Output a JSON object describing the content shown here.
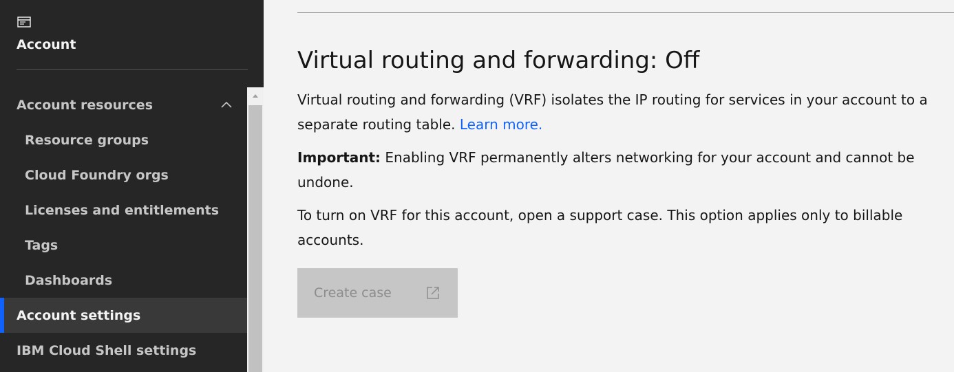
{
  "sidebar": {
    "title": "Account",
    "section_label": "Account resources",
    "items": [
      {
        "label": "Resource groups"
      },
      {
        "label": "Cloud Foundry orgs"
      },
      {
        "label": "Licenses and entitlements"
      },
      {
        "label": "Tags"
      },
      {
        "label": "Dashboards"
      }
    ],
    "account_settings_label": "Account settings",
    "shell_settings_label": "IBM Cloud Shell settings"
  },
  "main": {
    "heading": "Virtual routing and forwarding: Off",
    "intro_text": "Virtual routing and forwarding (VRF) isolates the IP routing for services in your account to a separate routing table.",
    "learn_more": "Learn more.",
    "important_label": "Important:",
    "important_text": "Enabling VRF permanently alters networking for your account and cannot be undone.",
    "instruction_text": "To turn on VRF for this account, open a support case. This option applies only to billable accounts.",
    "create_case_label": "Create case"
  },
  "colors": {
    "sidebar_bg": "#262626",
    "active_item_bg": "#393939",
    "accent": "#0f62fe",
    "main_bg": "#f3f3f3",
    "disabled_button_bg": "#c6c6c6"
  },
  "icons": {
    "account": "account-card-icon",
    "section_toggle": "chevron-up-icon",
    "create_case": "launch-icon"
  }
}
